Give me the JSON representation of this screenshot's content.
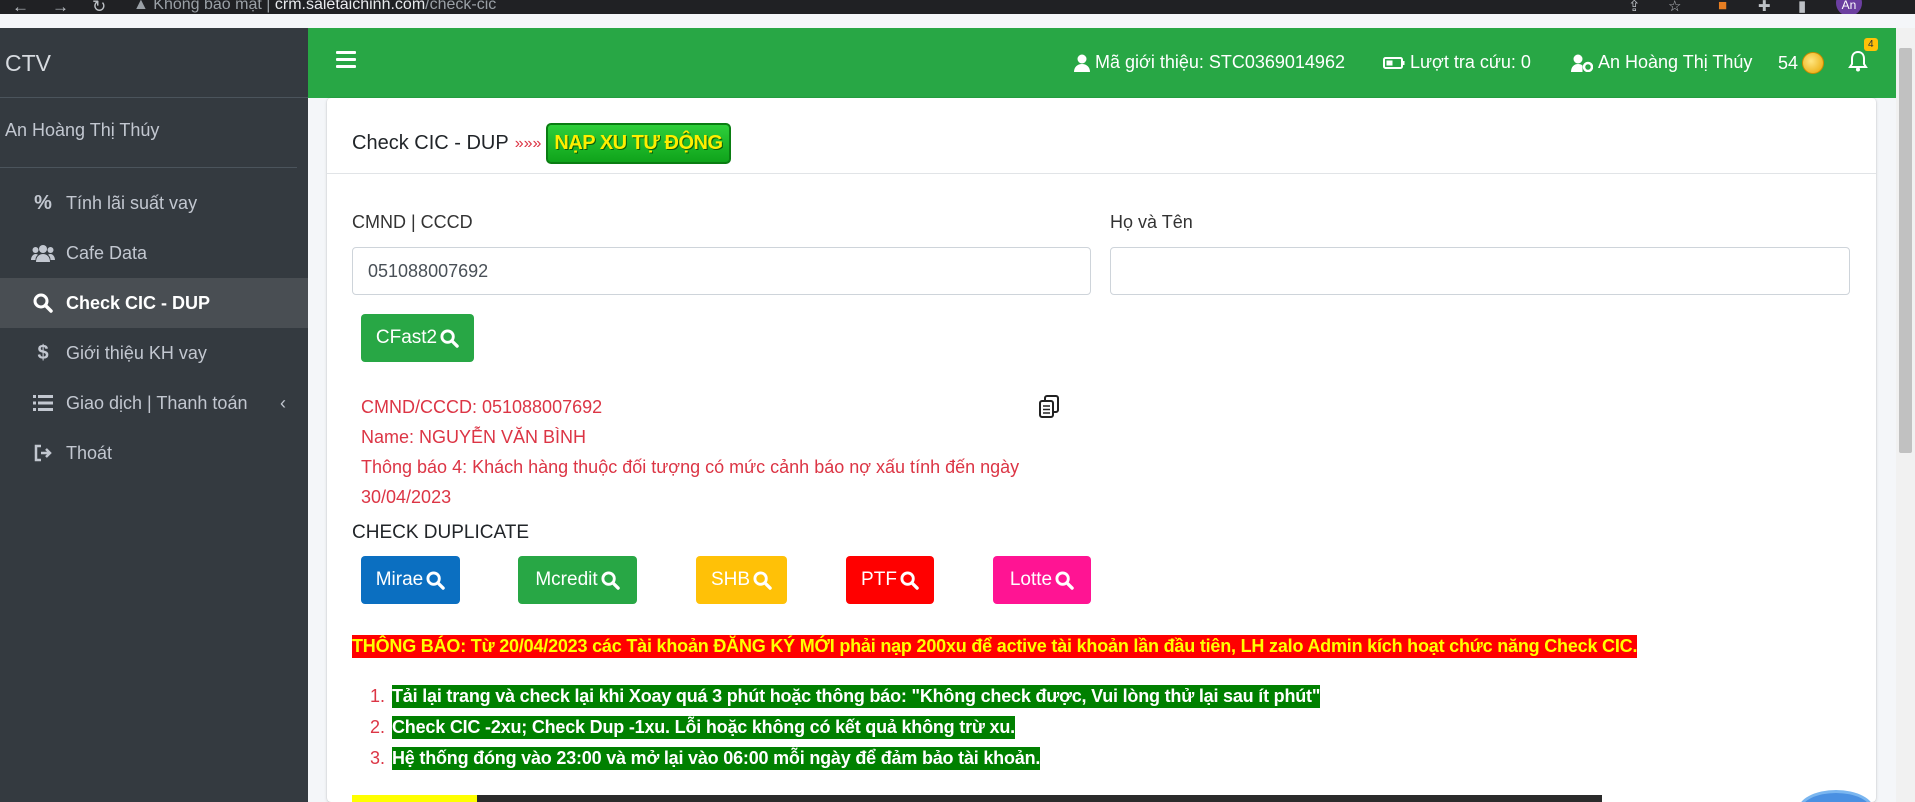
{
  "browser": {
    "security_label": "Không bảo mật",
    "url_host": "crm.saletaichinh.com",
    "url_path": "/check-cic",
    "profile_initials": "An"
  },
  "sidebar": {
    "brand": "CTV",
    "user_name": "An Hoàng Thị Thúy",
    "items": [
      {
        "label": "Tính lãi suất vay",
        "icon": "percent-icon"
      },
      {
        "label": "Cafe Data",
        "icon": "users-icon"
      },
      {
        "label": "Check CIC - DUP",
        "icon": "search-icon",
        "active": true
      },
      {
        "label": "Giới thiệu KH vay",
        "icon": "dollar-icon"
      },
      {
        "label": "Giao dịch | Thanh toán",
        "icon": "list-icon",
        "chevron": "chevron-left-icon"
      },
      {
        "label": "Thoát",
        "icon": "sign-out-icon"
      }
    ]
  },
  "topbar": {
    "referral": "Mã giới thiệu: STC0369014962",
    "lookups": "Lượt tra cứu: 0",
    "user": "An Hoàng Thị Thúy",
    "coins": "54",
    "notifications": "4"
  },
  "page": {
    "title": "Check CIC - DUP",
    "arrows": "»»»",
    "topup_badge": "NẠP XU TỰ ĐỘNG",
    "id_label": "CMND | CCCD",
    "id_value": "051088007692",
    "name_label": "Họ và Tên",
    "name_value": "",
    "cfast_button": "CFast2",
    "result": {
      "line1": "CMND/CCCD: 051088007692",
      "line2": "Name: NGUYỄN VĂN BÌNH",
      "line3": "Thông báo 4: Khách hàng thuộc đối tượng có mức cảnh báo nợ xấu tính đến ngày",
      "line4": "30/04/2023"
    },
    "duplicate_title": "CHECK DUPLICATE",
    "dup_buttons": [
      {
        "label": "Mirae",
        "color": "#0b6fc1"
      },
      {
        "label": "Mcredit",
        "color": "#28a745"
      },
      {
        "label": "SHB",
        "color": "#ffc107"
      },
      {
        "label": "PTF",
        "color": "#ff0000"
      },
      {
        "label": "Lotte",
        "color": "#ff1493"
      }
    ],
    "notice": "THÔNG BÁO: Từ 20/04/2023 các Tài khoản ĐĂNG KÝ MỚI phải nạp 200xu để active tài khoản lần đầu tiên, LH zalo Admin kích hoạt chức năng Check CIC.",
    "rules": [
      {
        "num": "1.",
        "text": "Tải lại trang và check lại khi Xoay quá 3 phút hoặc thông báo: \"Không check được, Vui lòng thử lại sau ít phút\""
      },
      {
        "num": "2.",
        "text": "Check CIC -2xu; Check Dup -1xu. Lỗi hoặc không có kết quả không trừ xu."
      },
      {
        "num": "3.",
        "text": "Hệ thống đóng vào 23:00 và mở lại vào 06:00 mỗi ngày để đảm bảo tài khoản."
      }
    ]
  },
  "colors": {
    "sidebar_bg": "#343a40",
    "topbar_bg": "#28a745",
    "result_text": "#dc3545"
  }
}
